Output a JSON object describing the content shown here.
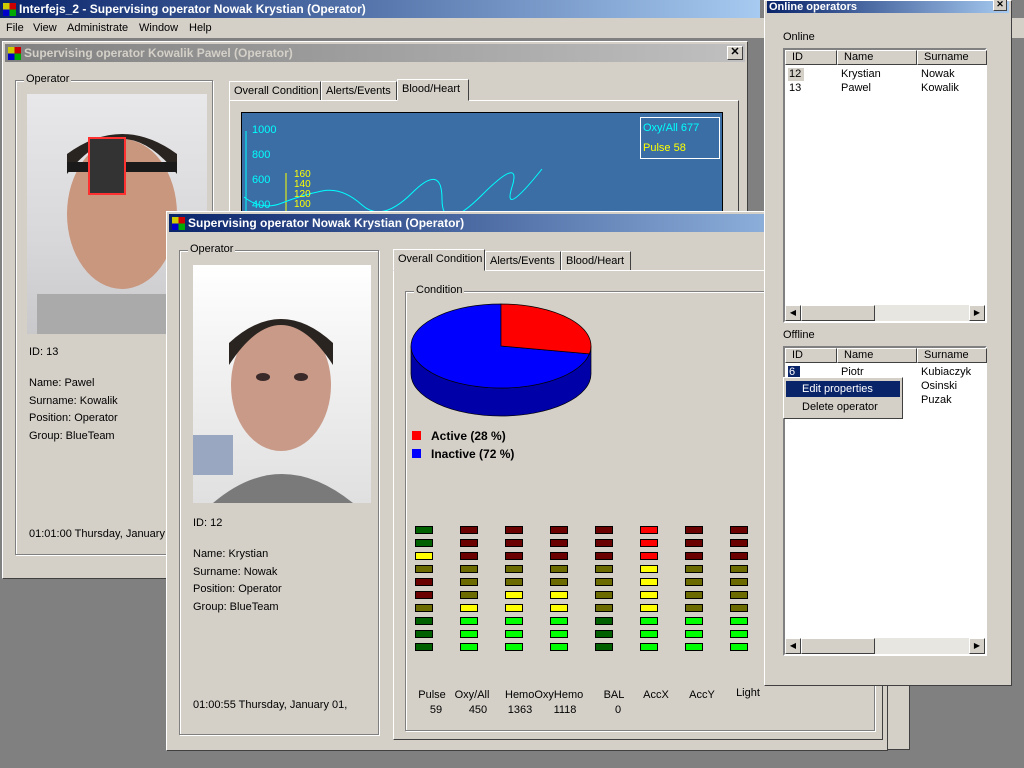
{
  "app": {
    "title": "Interfejs_2 - Supervising operator Nowak Krystian (Operator)",
    "menu": [
      "File",
      "View",
      "Administrate",
      "Window",
      "Help"
    ]
  },
  "back_window": {
    "title": "Supervising operator Kowalik Pawel (Operator)",
    "group_label": "Operator",
    "id_text": "ID: 13",
    "name": "Name: Pawel",
    "surname": "Surname: Kowalik",
    "position": "Position: Operator",
    "group": "Group: BlueTeam",
    "time": "01:01:00  Thursday, January",
    "tabs": [
      "Overall Condition",
      "Alerts/Events",
      "Blood/Heart"
    ],
    "selected_tab": "Blood/Heart",
    "plot_axis_ticks": [
      "1000",
      "800",
      "600",
      "400"
    ],
    "plot_axis_ticks2": [
      "160",
      "140",
      "120",
      "100"
    ],
    "legend": [
      "Oxy/All 677",
      "Pulse 58"
    ]
  },
  "front_window": {
    "title": "Supervising operator Nowak Krystian (Operator)",
    "group_label": "Operator",
    "id_text": "ID: 12",
    "name": "Name: Krystian",
    "surname": "Surname: Nowak",
    "position": "Position: Operator",
    "group": "Group: BlueTeam",
    "time": "01:00:55  Thursday, January 01,",
    "tabs": [
      "Overall Condition",
      "Alerts/Events",
      "Blood/Heart"
    ],
    "selected_tab": "Overall Condition",
    "condition_label": "Condition",
    "active_label": "Active (28 %)",
    "inactive_label": "Inactive (72 %)",
    "active_pct": 28,
    "inactive_pct": 72,
    "active_color": "#ff0000",
    "inactive_color": "#0000ff",
    "bar_labels": [
      "Pulse",
      "Oxy/All",
      "HemoOxyHemo",
      "BAL",
      "AccX",
      "AccY",
      "Light"
    ],
    "bar_label_list": [
      {
        "name": "Pulse",
        "value": "59"
      },
      {
        "name": "Oxy/All",
        "value": "450"
      },
      {
        "name": "Hemo",
        "value": "1363"
      },
      {
        "name": "OxyHemo",
        "value": "1118"
      },
      {
        "name": "BAL",
        "value": "0"
      },
      {
        "name": "AccX",
        "value": ""
      },
      {
        "name": "AccY",
        "value": ""
      },
      {
        "name": "Light",
        "value": ""
      }
    ]
  },
  "online_panel": {
    "title": "Online operators",
    "online_label": "Online",
    "offline_label": "Offline",
    "columns": [
      "ID",
      "Name",
      "Surname"
    ],
    "online_rows": [
      {
        "id": "12",
        "name": "Krystian",
        "surname": "Nowak"
      },
      {
        "id": "13",
        "name": "Pawel",
        "surname": "Kowalik"
      }
    ],
    "offline_rows": [
      {
        "id": "6",
        "name": "Piotr",
        "surname": "Kubiaczyk"
      },
      {
        "id": "",
        "name": "",
        "surname": "Osinski"
      },
      {
        "id": "",
        "name": "",
        "surname": "Puzak"
      }
    ],
    "context_menu": [
      "Edit properties",
      "Delete operator"
    ]
  }
}
